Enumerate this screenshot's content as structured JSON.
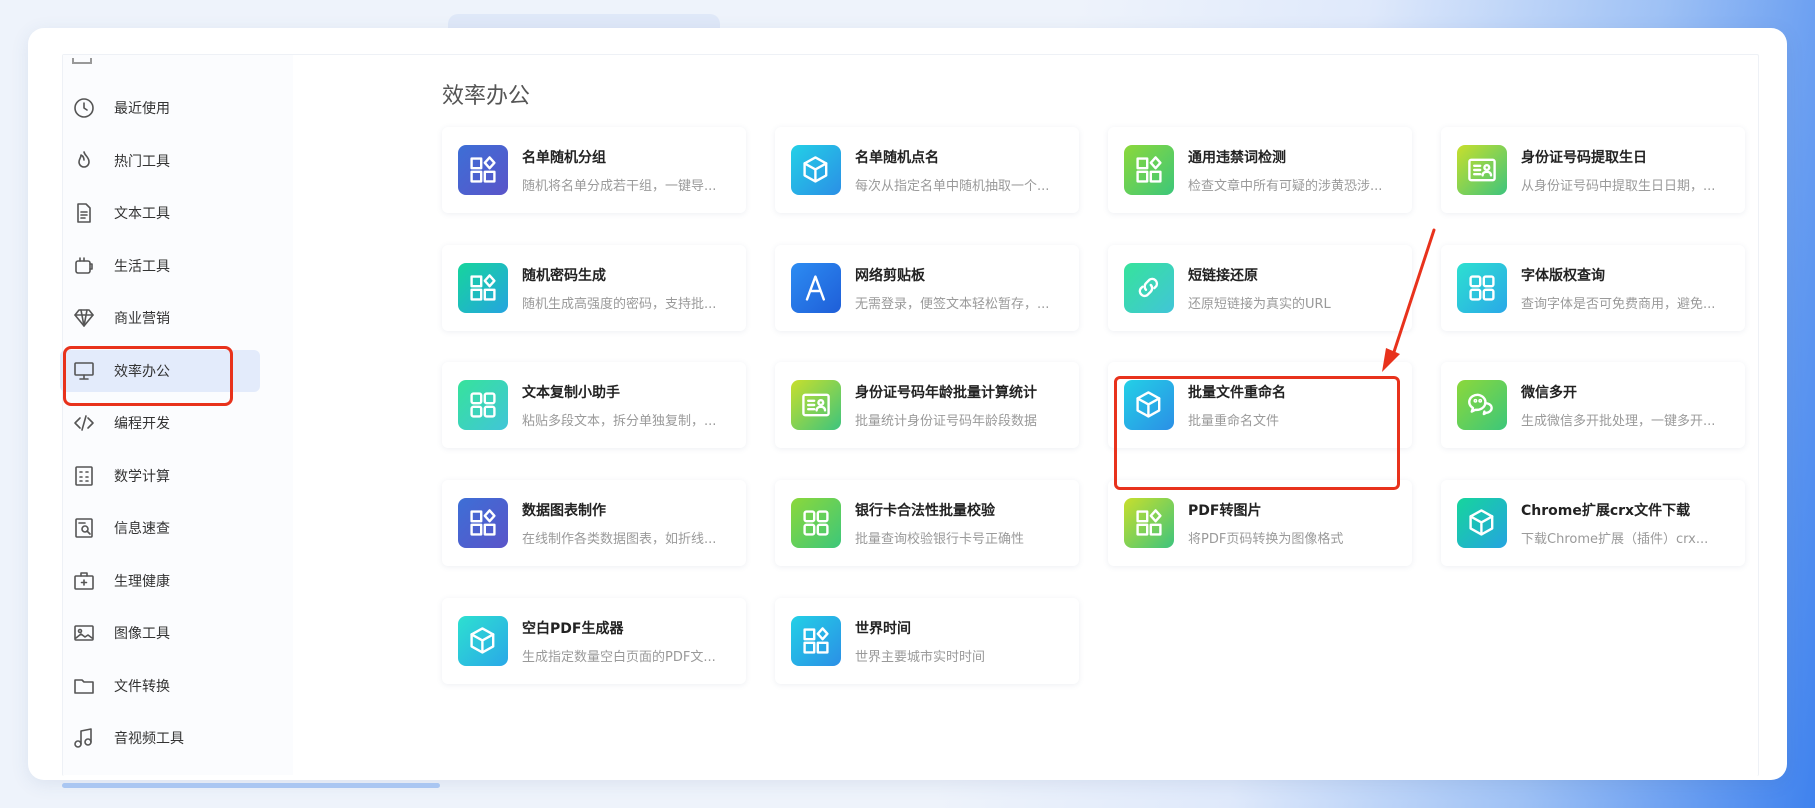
{
  "sidebar": {
    "items": [
      {
        "label": "最近使用",
        "icon": "clock-icon"
      },
      {
        "label": "热门工具",
        "icon": "flame-icon"
      },
      {
        "label": "文本工具",
        "icon": "document-icon"
      },
      {
        "label": "生活工具",
        "icon": "life-icon"
      },
      {
        "label": "商业营销",
        "icon": "diamond-icon"
      },
      {
        "label": "效率办公",
        "icon": "monitor-icon"
      },
      {
        "label": "编程开发",
        "icon": "code-icon"
      },
      {
        "label": "数学计算",
        "icon": "calculator-icon"
      },
      {
        "label": "信息速查",
        "icon": "search-doc-icon"
      },
      {
        "label": "生理健康",
        "icon": "medkit-icon"
      },
      {
        "label": "图像工具",
        "icon": "image-icon"
      },
      {
        "label": "文件转换",
        "icon": "folder-icon"
      },
      {
        "label": "音视频工具",
        "icon": "music-icon"
      }
    ],
    "active_index": 5
  },
  "main": {
    "title": "效率办公",
    "cards": [
      {
        "title": "名单随机分组",
        "desc": "随机将名单分成若干组，一键导...",
        "icon": "grid-diamond-icon",
        "color": "blue"
      },
      {
        "title": "名单随机点名",
        "desc": "每次从指定名单中随机抽取一个...",
        "icon": "cube-icon",
        "color": "cyan"
      },
      {
        "title": "通用违禁词检测",
        "desc": "检查文章中所有可疑的涉黄恐涉...",
        "icon": "grid-diamond-icon",
        "color": "green"
      },
      {
        "title": "身份证号码提取生日",
        "desc": "从身份证号码中提取生日日期，...",
        "icon": "id-card-icon",
        "color": "lime"
      },
      {
        "title": "随机密码生成",
        "desc": "随机生成高强度的密码，支持批...",
        "icon": "grid-diamond-icon",
        "color": "teal"
      },
      {
        "title": "网络剪贴板",
        "desc": "无需登录，便签文本轻松暂存，...",
        "icon": "letter-a-icon",
        "color": "royal"
      },
      {
        "title": "短链接还原",
        "desc": "还原短链接为真实的URL",
        "icon": "link-icon",
        "color": "mint"
      },
      {
        "title": "字体版权查询",
        "desc": "查询字体是否可免费商用，避免...",
        "icon": "grid-icon",
        "color": "aqua"
      },
      {
        "title": "文本复制小助手",
        "desc": "粘贴多段文本，拆分单独复制，...",
        "icon": "grid-icon",
        "color": "mint"
      },
      {
        "title": "身份证号码年龄批量计算统计",
        "desc": "批量统计身份证号码年龄段数据",
        "icon": "id-card-icon",
        "color": "lime"
      },
      {
        "title": "批量文件重命名",
        "desc": "批量重命名文件",
        "icon": "cube-icon",
        "color": "cyan"
      },
      {
        "title": "微信多开",
        "desc": "生成微信多开批处理，一键多开...",
        "icon": "wechat-icon",
        "color": "green"
      },
      {
        "title": "数据图表制作",
        "desc": "在线制作各类数据图表，如折线...",
        "icon": "grid-diamond-icon",
        "color": "blue"
      },
      {
        "title": "银行卡合法性批量校验",
        "desc": "批量查询校验银行卡号正确性",
        "icon": "grid-icon",
        "color": "green"
      },
      {
        "title": "PDF转图片",
        "desc": "将PDF页码转换为图像格式",
        "icon": "grid-diamond-icon",
        "color": "lime"
      },
      {
        "title": "Chrome扩展crx文件下载",
        "desc": "下载Chrome扩展（插件）crx...",
        "icon": "cube-icon",
        "color": "teal"
      },
      {
        "title": "空白PDF生成器",
        "desc": "生成指定数量空白页面的PDF文...",
        "icon": "cube-icon",
        "color": "aqua"
      },
      {
        "title": "世界时间",
        "desc": "世界主要城市实时时间",
        "icon": "grid-diamond-icon",
        "color": "cyan"
      }
    ],
    "highlighted_card_index": 10
  },
  "colors": {
    "accent": "#3f82ee",
    "highlight": "#e8321c",
    "active_nav_bg": "#e3ebfb"
  }
}
